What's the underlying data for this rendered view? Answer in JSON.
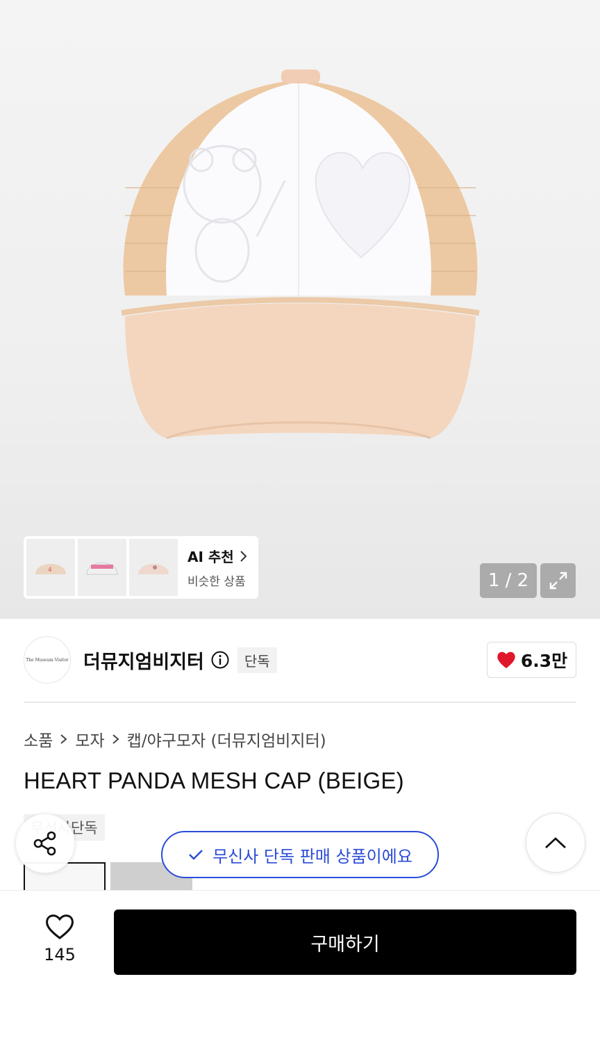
{
  "gallery": {
    "counter": "1 / 2",
    "ai_recommend": {
      "title": "AI 추천",
      "subtitle": "비슷한 상품"
    }
  },
  "brand": {
    "logo_text": "The Museum Visitor",
    "name": "더뮤지엄비지터",
    "exclusive_tag": "단독",
    "likes": "6.3만",
    "heart_color": "#e0172b"
  },
  "breadcrumb": [
    "소품",
    "모자",
    "캡/야구모자 (더뮤지엄비지터)"
  ],
  "product": {
    "title": "HEART PANDA MESH CAP (BEIGE)",
    "exclusive_label": "무신사단독"
  },
  "toast": {
    "text": "무신사 단독 판매 상품이에요",
    "color": "#2a4bd7"
  },
  "bottom_bar": {
    "wish_count": "145",
    "buy_label": "구매하기"
  }
}
